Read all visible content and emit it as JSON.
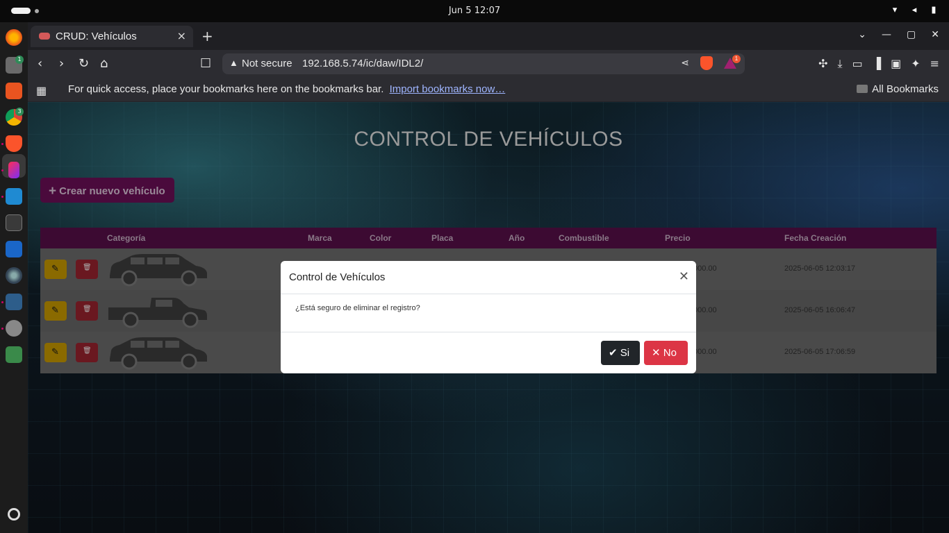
{
  "system": {
    "clock": "Jun 5  12:07"
  },
  "dock": {
    "files_badge": "1",
    "chrome_badge": "3"
  },
  "browser": {
    "tab_title": "CRUD: Vehículos",
    "tab_close": "×",
    "new_tab": "+",
    "security_label": "Not secure",
    "url": "192.168.5.74/ic/daw/IDL2/",
    "rewards_badge": "1",
    "bookmarks_message": "For quick access, place your bookmarks here on the bookmarks bar.",
    "import_link": "Import bookmarks now…",
    "all_bookmarks": "All Bookmarks"
  },
  "page": {
    "title": "CONTROL DE VEHÍCULOS",
    "create_button": "Crear nuevo vehículo",
    "columns": [
      "Categoría",
      "Marca",
      "Color",
      "Placa",
      "Año",
      "Combustible",
      "Precio",
      "Fecha Creación"
    ],
    "rows": [
      {
        "category_icon": "hatchback-car-icon",
        "price_visible": "000.00",
        "created": "2025-06-05 12:03:17"
      },
      {
        "category_icon": "pickup-truck-icon",
        "price_visible": "000.00",
        "created": "2025-06-05 16:06:47"
      },
      {
        "category_icon": "hatchback-car-icon",
        "price_visible": "000.00",
        "created": "2025-06-05 17:06:59"
      }
    ]
  },
  "modal": {
    "title": "Control de Vehículos",
    "message": "¿Está seguro de eliminar el registro?",
    "yes_label": "Si",
    "no_label": "No"
  },
  "colors": {
    "header_bg": "#3c0a32",
    "edit_btn": "#8a6a00",
    "delete_btn": "#6a1820",
    "no_btn": "#dc3545",
    "si_btn": "#212529"
  }
}
